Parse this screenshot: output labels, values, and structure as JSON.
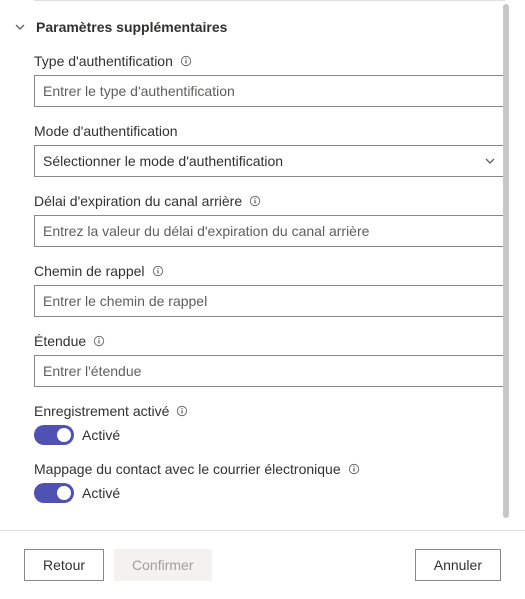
{
  "section": {
    "title": "Paramètres supplémentaires"
  },
  "fields": {
    "authType": {
      "label": "Type d'authentification",
      "placeholder": "Entrer le type d'authentification",
      "value": ""
    },
    "authMode": {
      "label": "Mode d'authentification",
      "selected": "Sélectionner le mode d'authentification"
    },
    "backChannelTimeout": {
      "label": "Délai d'expiration du canal arrière",
      "placeholder": "Entrez la valeur du délai d'expiration du canal arrière",
      "value": ""
    },
    "callbackPath": {
      "label": "Chemin de rappel",
      "placeholder": "Entrer le chemin de rappel",
      "value": ""
    },
    "scope": {
      "label": "Étendue",
      "placeholder": "Entrer l'étendue",
      "value": ""
    },
    "registrationEnabled": {
      "label": "Enregistrement activé",
      "stateText": "Activé"
    },
    "contactEmailMapping": {
      "label": "Mappage du contact avec le courrier électronique",
      "stateText": "Activé"
    }
  },
  "footer": {
    "back": "Retour",
    "confirm": "Confirmer",
    "cancel": "Annuler"
  }
}
